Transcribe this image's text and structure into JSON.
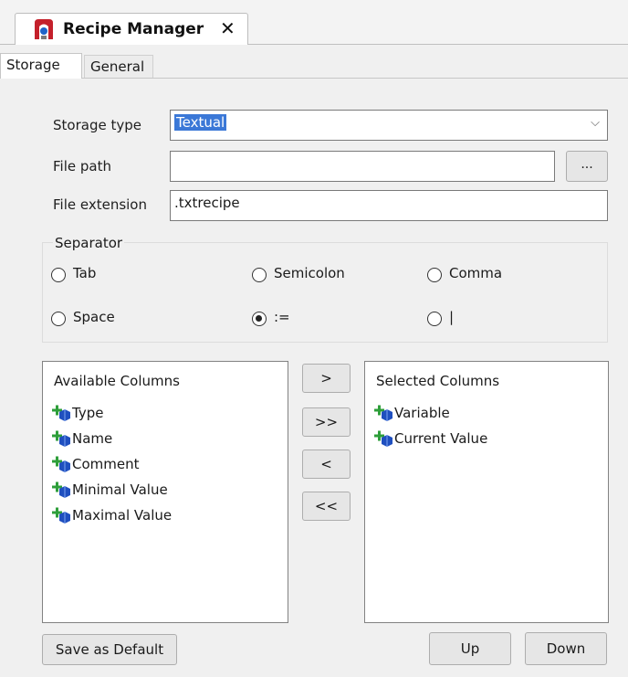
{
  "editor_tab": {
    "title": "Recipe Manager",
    "close": "✕",
    "icon": "recipe-manager-icon"
  },
  "tabs": [
    {
      "label": "Storage",
      "active": true
    },
    {
      "label": "General",
      "active": false
    }
  ],
  "storage": {
    "storage_type_label": "Storage type",
    "storage_type_value": "Textual",
    "file_path_label": "File path",
    "file_path_value": "",
    "browse_label": "...",
    "file_extension_label": "File extension",
    "file_extension_value": ".txtrecipe"
  },
  "separator": {
    "title": "Separator",
    "options": [
      {
        "label": "Tab",
        "checked": false
      },
      {
        "label": "Semicolon",
        "checked": false
      },
      {
        "label": "Comma",
        "checked": false
      },
      {
        "label": "Space",
        "checked": false
      },
      {
        "label": ":=",
        "checked": true
      },
      {
        "label": "|",
        "checked": false
      }
    ]
  },
  "available": {
    "title": "Available Columns",
    "items": [
      "Type",
      "Name",
      "Comment",
      "Minimal Value",
      "Maximal Value"
    ]
  },
  "selected": {
    "title": "Selected Columns",
    "items": [
      "Variable",
      "Current Value"
    ]
  },
  "move_buttons": {
    "add": ">",
    "add_all": ">>",
    "remove": "<",
    "remove_all": "<<"
  },
  "bottom": {
    "save_default": "Save as Default",
    "up": "Up",
    "down": "Down"
  },
  "colors": {
    "accent": "#3b78d7",
    "icon_green": "#2e9e3a",
    "icon_blue": "#1f4fbf"
  }
}
